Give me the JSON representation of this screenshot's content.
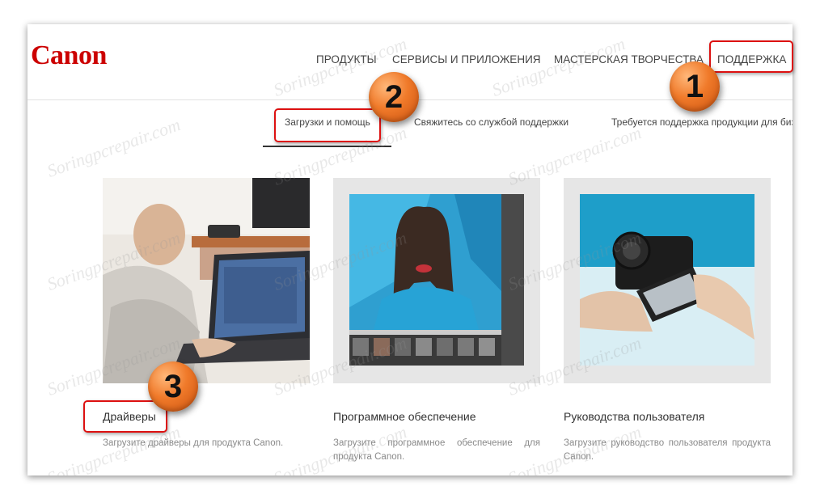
{
  "brand": {
    "logo": "Canon",
    "color": "#cc0000"
  },
  "nav": {
    "items": [
      {
        "label": "ПРОДУКТЫ"
      },
      {
        "label": "СЕРВИСЫ И ПРИЛОЖЕНИЯ"
      },
      {
        "label": "МАСТЕРСКАЯ ТВОРЧЕСТВА"
      },
      {
        "label": "ПОДДЕРЖКА"
      }
    ]
  },
  "subnav": {
    "items": [
      {
        "label": "Загрузки и помощь"
      },
      {
        "label": "Свяжитесь со службой поддержки"
      },
      {
        "label": "Требуется поддержка продукции для биз"
      }
    ]
  },
  "cards": [
    {
      "title": "Драйверы",
      "desc": "Загрузите драйверы для продукта Canon.",
      "image": "laptop-user-photo"
    },
    {
      "title": "Программное обеспечение",
      "desc": "Загрузите программное обеспечение для продукта Canon.",
      "image": "photo-editor-screenshot"
    },
    {
      "title": "Руководства пользователя",
      "desc": "Загрузите руководство пользователя продукта Canon.",
      "image": "camera-in-hands-photo"
    }
  ],
  "annotations": {
    "badges": [
      "1",
      "2",
      "3"
    ],
    "highlight_color": "#d11111",
    "badge_color": "#f07a2a"
  },
  "watermark": "Soringpcrepair.com"
}
